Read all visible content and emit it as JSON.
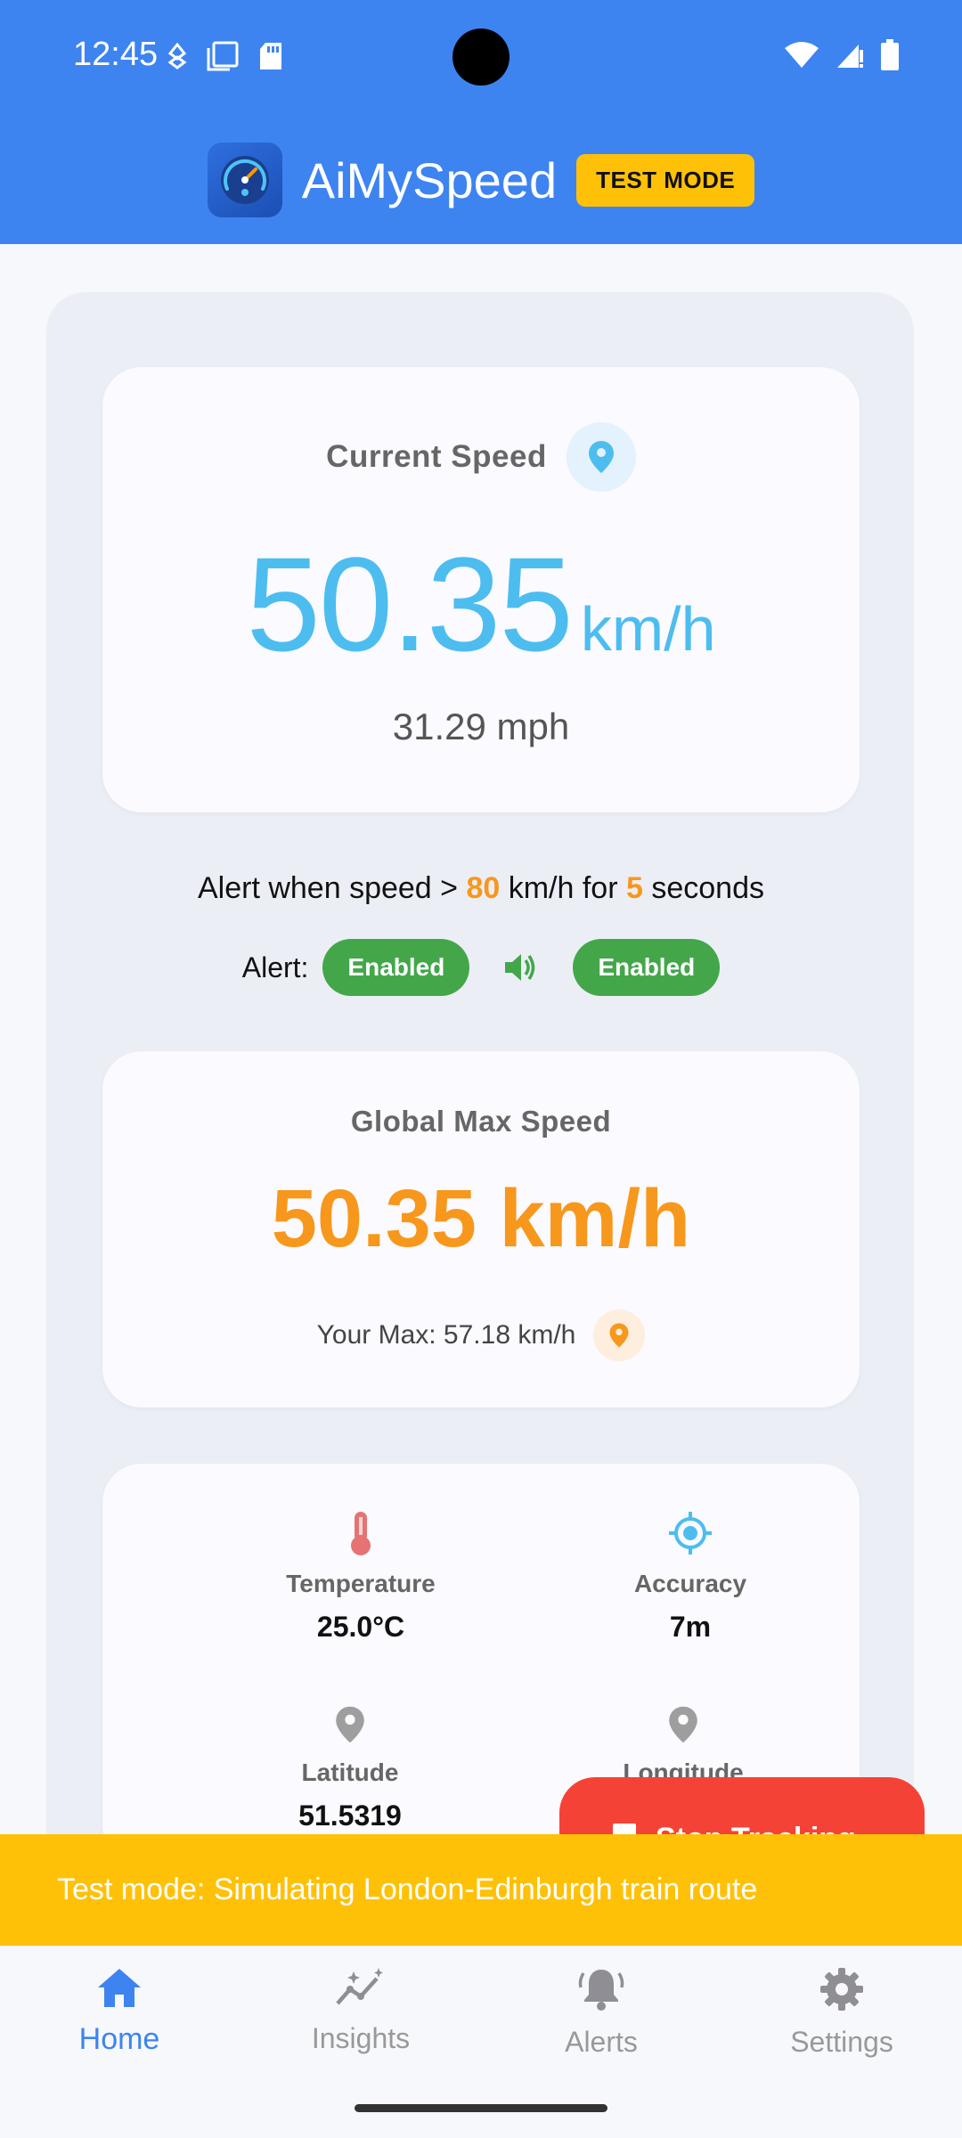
{
  "status_bar": {
    "time": "12:45"
  },
  "app_bar": {
    "title": "AiMySpeed",
    "badge": "TEST MODE"
  },
  "current_speed": {
    "title": "Current Speed",
    "value": "50.35",
    "unit": "km/h",
    "secondary": "31.29 mph"
  },
  "alert_settings": {
    "prefix": "Alert when speed > ",
    "threshold": "80",
    "middle": " km/h for ",
    "duration": "5",
    "suffix": " seconds",
    "alert_label": "Alert:",
    "alert_status": "Enabled",
    "sound_status": "Enabled"
  },
  "global_max": {
    "title": "Global Max Speed",
    "value": "50.35 km/h",
    "your_max": "Your Max: 57.18 km/h"
  },
  "info": {
    "temperature_label": "Temperature",
    "temperature_value": "25.0°C",
    "accuracy_label": "Accuracy",
    "accuracy_value": "7m",
    "latitude_label": "Latitude",
    "latitude_value": "51.5319",
    "longitude_label": "Longitude"
  },
  "fab": {
    "label": "Stop Tracking"
  },
  "test_banner": {
    "text": "Test mode: Simulating London-Edinburgh train route"
  },
  "nav": {
    "items": [
      {
        "label": "Home"
      },
      {
        "label": "Insights"
      },
      {
        "label": "Alerts"
      },
      {
        "label": "Settings"
      }
    ]
  },
  "colors": {
    "primary": "#3d84f0",
    "speed": "#4dbdf0",
    "max": "#f7971c",
    "enabled": "#43a74a",
    "stop": "#f44336",
    "warning": "#ffc107"
  }
}
